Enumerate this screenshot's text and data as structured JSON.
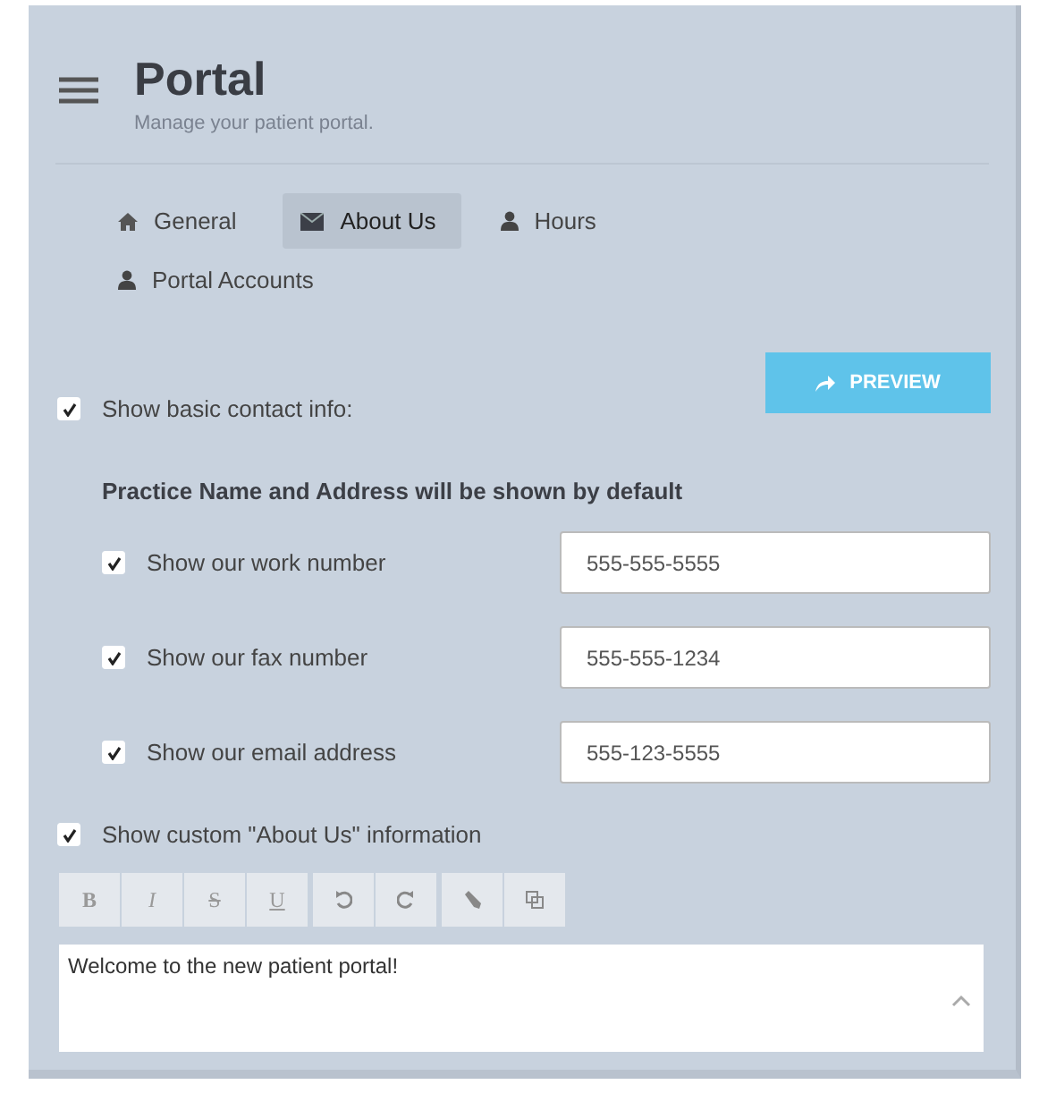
{
  "header": {
    "title": "Portal",
    "subtitle": "Manage your patient portal."
  },
  "tabs": [
    {
      "label": "General",
      "selected": false
    },
    {
      "label": "About Us",
      "selected": true
    },
    {
      "label": "Hours",
      "selected": false
    },
    {
      "label": "Portal Accounts",
      "selected": false
    }
  ],
  "preview_button": "PREVIEW",
  "basic_contact": {
    "label": "Show basic contact info:",
    "checked": true
  },
  "default_note": "Practice Name and Address will be shown by default",
  "contact_rows": [
    {
      "label": "Show our work number",
      "checked": true,
      "value": "555-555-5555"
    },
    {
      "label": "Show our fax number",
      "checked": true,
      "value": "555-555-1234"
    },
    {
      "label": "Show our email address",
      "checked": true,
      "value": "555-123-5555"
    }
  ],
  "custom_about": {
    "label": "Show custom \"About Us\" information",
    "checked": true
  },
  "toolbar": [
    [
      {
        "kind": "bold",
        "text": "B"
      },
      {
        "kind": "italic",
        "text": "I"
      },
      {
        "kind": "strike",
        "text": "S"
      },
      {
        "kind": "underline",
        "text": "U"
      }
    ],
    [
      {
        "kind": "undo"
      },
      {
        "kind": "redo"
      }
    ],
    [
      {
        "kind": "pencil"
      },
      {
        "kind": "copy"
      }
    ]
  ],
  "editor": {
    "value": "Welcome to the new patient portal!"
  }
}
